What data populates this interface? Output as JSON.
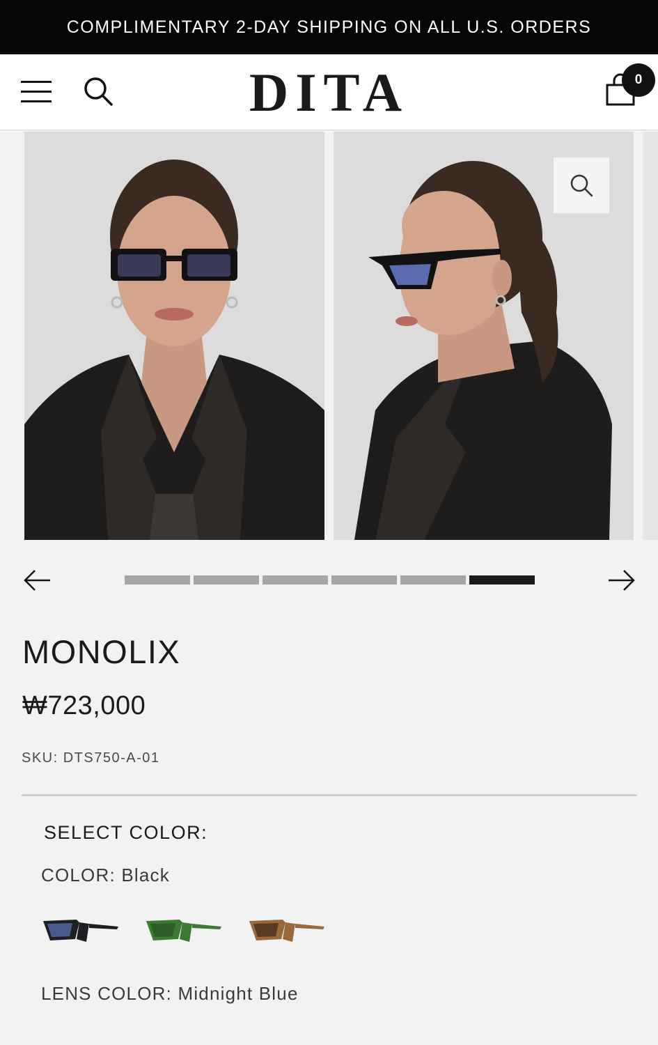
{
  "promo": {
    "text": "COMPLIMENTARY 2-DAY SHIPPING ON ALL U.S. ORDERS"
  },
  "header": {
    "logo": "DITA",
    "cart_count": "0",
    "icons": [
      "menu-icon",
      "search-icon",
      "shopping-bag-icon"
    ]
  },
  "gallery": {
    "slide_count": 6,
    "active_slide": 6,
    "images": [
      "model-front-view",
      "model-side-profile-view"
    ],
    "icons": [
      "zoom-icon",
      "arrow-left-icon",
      "arrow-right-icon"
    ]
  },
  "product": {
    "name": "MONOLIX",
    "price": "₩723,000",
    "sku": "SKU: DTS750-A-01"
  },
  "options": {
    "select_color_label": "SELECT COLOR:",
    "color_label": "COLOR:",
    "color_value": "Black",
    "lens_label": "LENS COLOR:",
    "lens_value": "Midnight Blue",
    "swatches": [
      {
        "name": "Black",
        "frame": "#1e1f24",
        "lens": "#4a5a8c"
      },
      {
        "name": "Green",
        "frame": "#3c7a34",
        "lens": "#2e5f28"
      },
      {
        "name": "Tortoise",
        "frame": "#9a6a3c",
        "lens": "#5a3a22"
      }
    ]
  },
  "colors": {
    "promo_bg": "#050505",
    "page_bg": "#f2f2f2",
    "active_dot": "#1a1a1a",
    "inactive_dot": "#a6a6a6"
  }
}
